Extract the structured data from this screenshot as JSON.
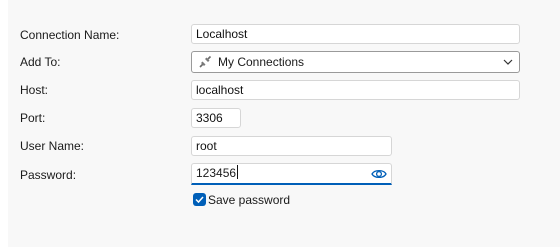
{
  "form": {
    "connection_name": {
      "label": "Connection Name:",
      "value": "Localhost"
    },
    "add_to": {
      "label": "Add To:",
      "value": "My Connections",
      "icon": "connection-plug-icon"
    },
    "host": {
      "label": "Host:",
      "value": "localhost"
    },
    "port": {
      "label": "Port:",
      "value": "3306"
    },
    "user_name": {
      "label": "User Name:",
      "value": "root"
    },
    "password": {
      "label": "Password:",
      "value": "123456",
      "reveal_icon": "eye-icon"
    },
    "save_password": {
      "label": "Save password",
      "checked": true
    }
  },
  "colors": {
    "accent": "#005fb8",
    "panel": "#f8f8f8",
    "field_border": "#d6d6d6"
  }
}
